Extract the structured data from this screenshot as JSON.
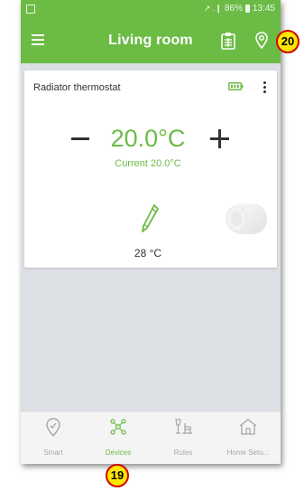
{
  "status_bar": {
    "battery_percent": "86%",
    "time": "13:45",
    "signal": "↗ .❙"
  },
  "app_bar": {
    "title": "Living room",
    "icons": [
      "menu-icon",
      "clipboard-icon",
      "location-pin-icon"
    ]
  },
  "annotations": {
    "top_badge": "20",
    "bottom_badge": "19"
  },
  "device_card": {
    "name": "Radiator thermostat",
    "target_temperature": "20.0°C",
    "current_temperature": "Current 20.0°C",
    "valve_temperature": "28 °C",
    "icons": [
      "battery-full-icon",
      "more-vert-icon",
      "minus-icon",
      "plus-icon",
      "pencil-icon"
    ]
  },
  "bottom_nav": {
    "items": [
      {
        "label": "Smart",
        "icon": "smart-pin-icon",
        "active": false
      },
      {
        "label": "Devices",
        "icon": "devices-network-icon",
        "active": true
      },
      {
        "label": "Rules",
        "icon": "rules-icon",
        "active": false
      },
      {
        "label": "Home Setu...",
        "icon": "home-setup-icon",
        "active": false
      }
    ]
  },
  "colors": {
    "accent": "#6bbb45",
    "background": "#dcdfe3",
    "badge_fill": "#ffe600",
    "badge_border": "#d40000"
  }
}
